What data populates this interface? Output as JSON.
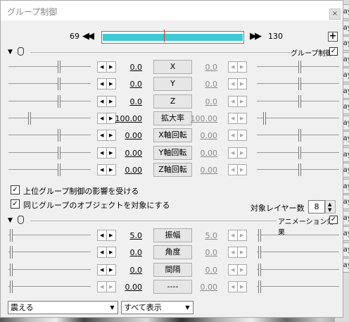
{
  "window": {
    "title": "グループ制御",
    "close_label": "×"
  },
  "frame": {
    "start": "69",
    "end": "130",
    "prev_icon": "◀◀",
    "next_icon": "▶▶",
    "add_label": "+"
  },
  "group_section": {
    "label": "グループ制御",
    "enabled_mark": "✓"
  },
  "group_rows": [
    {
      "name": "x",
      "label": "X",
      "left_value": "0.0",
      "right_value": "0.0",
      "left_pos": 0.62,
      "right_pos": 0.52
    },
    {
      "name": "y",
      "label": "Y",
      "left_value": "0.0",
      "right_value": "0.0",
      "left_pos": 0.62,
      "right_pos": 0.52
    },
    {
      "name": "z",
      "label": "Z",
      "left_value": "0.0",
      "right_value": "0.0",
      "left_pos": 0.62,
      "right_pos": 0.52
    },
    {
      "name": "zoom",
      "label": "拡大率",
      "left_value": "100.00",
      "right_value": "100.00",
      "left_pos": 0.25,
      "right_pos": 0.08
    },
    {
      "name": "x-rotation",
      "label": "X軸回転",
      "left_value": "0.00",
      "right_value": "0.00",
      "left_pos": 0.62,
      "right_pos": 0.52
    },
    {
      "name": "y-rotation",
      "label": "Y軸回転",
      "left_value": "0.00",
      "right_value": "0.00",
      "left_pos": 0.62,
      "right_pos": 0.52
    },
    {
      "name": "z-rotation",
      "label": "Z軸回転",
      "left_value": "0.00",
      "right_value": "0.00",
      "left_pos": 0.62,
      "right_pos": 0.52
    }
  ],
  "options": {
    "inherit_upper": {
      "label": "上位グループ制御の影響を受ける",
      "checked": "✓"
    },
    "same_group_target": {
      "label": "同じグループのオブジェクトを対象にする",
      "checked": "✓"
    },
    "layer_count_label": "対象レイヤー数",
    "layer_count_value": "8"
  },
  "anim_section": {
    "label": "アニメーション効果",
    "enabled_mark": "✓"
  },
  "anim_rows": [
    {
      "name": "amplitude",
      "label": "振幅",
      "left_value": "5.0",
      "right_value": "5.0",
      "left_pos": 0.02,
      "right_pos": 0.02
    },
    {
      "name": "angle",
      "label": "角度",
      "left_value": "0.0",
      "right_value": "0.0",
      "left_pos": 0.02,
      "right_pos": 0.02
    },
    {
      "name": "interval",
      "label": "間隔",
      "left_value": "0.0",
      "right_value": "0.0",
      "left_pos": 0.02,
      "right_pos": 0.02
    },
    {
      "name": "unused",
      "label": "----",
      "left_value": "0.00",
      "right_value": "0.00",
      "left_pos": 0.02,
      "right_pos": 0.02
    }
  ],
  "bottom": {
    "effect_select": "震える",
    "display_select": "すべて表示",
    "dropdown_icon": "▼"
  },
  "layer_strip": {
    "tab_label": "Layer"
  }
}
